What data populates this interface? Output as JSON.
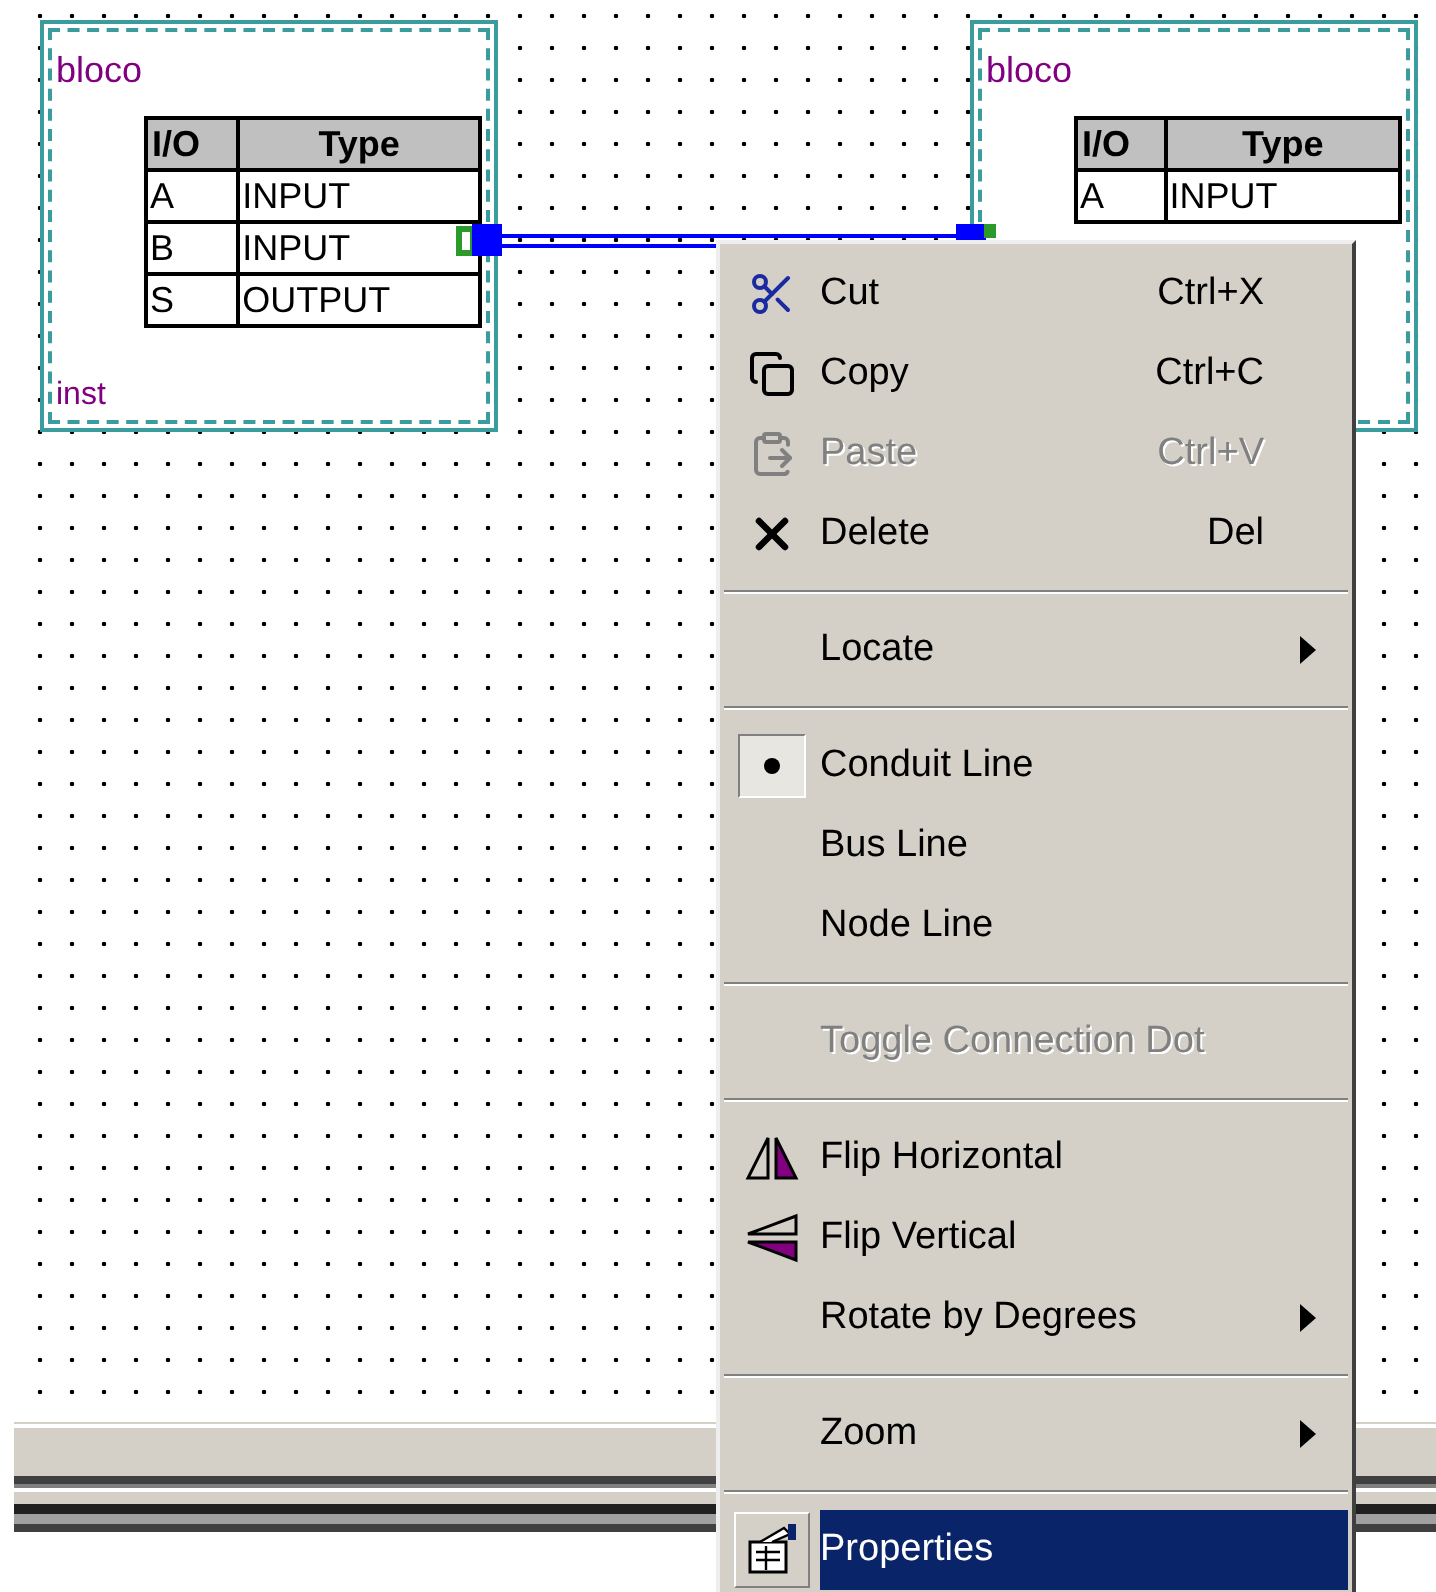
{
  "canvas": {
    "blocks": [
      {
        "title": "bloco",
        "instance": "inst",
        "columns": [
          "I/O",
          "Type"
        ],
        "rows": [
          [
            "A",
            "INPUT"
          ],
          [
            "B",
            "INPUT"
          ],
          [
            "S",
            "OUTPUT"
          ]
        ]
      },
      {
        "title": "bloco",
        "columns": [
          "I/O",
          "Type"
        ],
        "rows": [
          [
            "A",
            "INPUT"
          ]
        ]
      }
    ]
  },
  "context_menu": {
    "groups": [
      [
        {
          "kind": "command",
          "label": "Cut",
          "shortcut": "Ctrl+X",
          "disabled": false,
          "highlighted": false
        },
        {
          "kind": "command",
          "label": "Copy",
          "shortcut": "Ctrl+C",
          "disabled": false,
          "highlighted": false
        },
        {
          "kind": "command",
          "label": "Paste",
          "shortcut": "Ctrl+V",
          "disabled": true,
          "highlighted": false
        },
        {
          "kind": "command",
          "label": "Delete",
          "shortcut": "Del",
          "disabled": false,
          "highlighted": false
        }
      ],
      [
        {
          "kind": "submenu",
          "label": "Locate",
          "disabled": false,
          "highlighted": false
        }
      ],
      [
        {
          "kind": "radio",
          "label": "Conduit Line",
          "selected": true,
          "disabled": false,
          "highlighted": false
        },
        {
          "kind": "radio",
          "label": "Bus Line",
          "selected": false,
          "disabled": false,
          "highlighted": false
        },
        {
          "kind": "radio",
          "label": "Node Line",
          "selected": false,
          "disabled": false,
          "highlighted": false
        }
      ],
      [
        {
          "kind": "command",
          "label": "Toggle Connection Dot",
          "disabled": true,
          "highlighted": false
        }
      ],
      [
        {
          "kind": "command",
          "label": "Flip Horizontal",
          "disabled": false,
          "highlighted": false
        },
        {
          "kind": "command",
          "label": "Flip Vertical",
          "disabled": false,
          "highlighted": false
        },
        {
          "kind": "submenu",
          "label": "Rotate by Degrees",
          "disabled": false,
          "highlighted": false
        }
      ],
      [
        {
          "kind": "submenu",
          "label": "Zoom",
          "disabled": false,
          "highlighted": false
        }
      ],
      [
        {
          "kind": "command",
          "label": "Properties",
          "disabled": false,
          "highlighted": true
        }
      ]
    ]
  }
}
